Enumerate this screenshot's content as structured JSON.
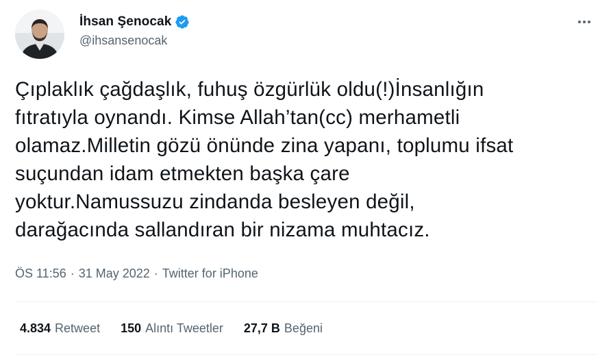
{
  "author": {
    "display_name": "İhsan Şenocak",
    "handle": "@ihsansenocak",
    "verified": true,
    "avatar_icon": "profile-photo"
  },
  "more_icon": "more-horizontal-icon",
  "tweet": {
    "text_lines": [
      "Çıplaklık çağdaşlık, fuhuş özgürlük oldu(!)İnsanlığın",
      "fıtratıyla oynandı. Kimse Allah’tan(cc) merhametli",
      "olamaz.Milletin gözü önünde zina yapanı, toplumu ifsat",
      "suçundan idam etmekten başka çare",
      "yoktur.Namussuzu zindanda besleyen değil,",
      "darağacında sallandıran bir nizama muhtacız."
    ]
  },
  "meta": {
    "time": "ÖS 11:56",
    "separator": "·",
    "date": "31 May 2022",
    "source": "Twitter for iPhone"
  },
  "stats": {
    "retweets": {
      "value": "4.834",
      "label": "Retweet"
    },
    "quotes": {
      "value": "150",
      "label": "Alıntı Tweetler"
    },
    "likes": {
      "value": "27,7 B",
      "label": "Beğeni"
    }
  },
  "colors": {
    "text_primary": "#0f1419",
    "text_secondary": "#536471",
    "verified_blue": "#1d9bf0",
    "divider": "#eff3f4"
  }
}
